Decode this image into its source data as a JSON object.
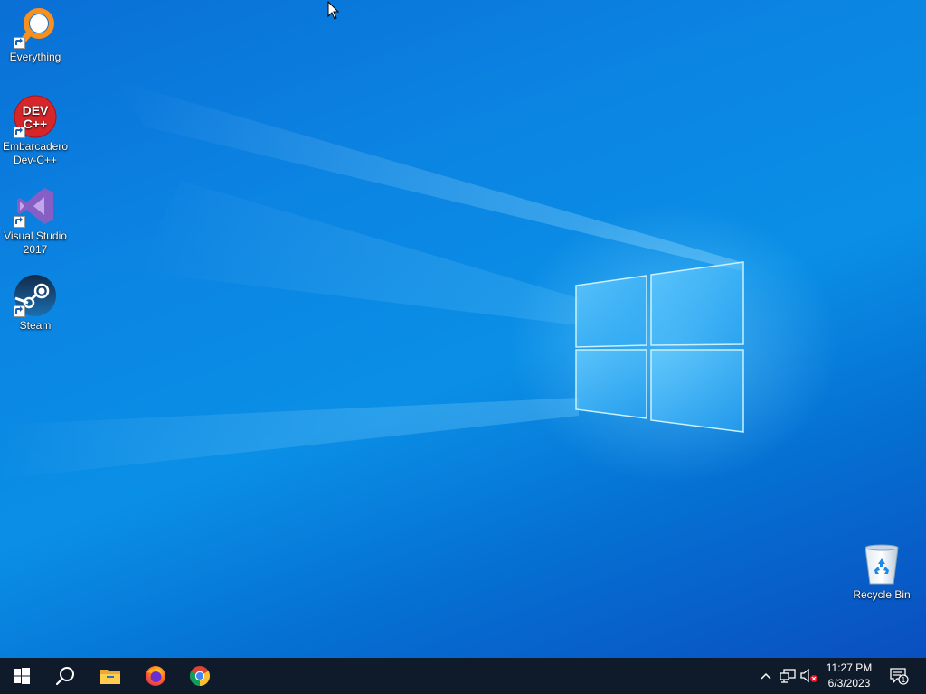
{
  "desktop": {
    "icons": [
      {
        "id": "everything",
        "label": "Everything"
      },
      {
        "id": "devcpp",
        "label": "Embarcadero Dev-C++"
      },
      {
        "id": "visual-studio",
        "label": "Visual Studio 2017"
      },
      {
        "id": "steam",
        "label": "Steam"
      },
      {
        "id": "recycle-bin",
        "label": "Recycle Bin"
      }
    ],
    "devcpp_logo_text": "DEV C++"
  },
  "taskbar": {
    "buttons": [
      "start-icon",
      "search-icon",
      "file-explorer-icon",
      "firefox-icon",
      "chrome-icon"
    ],
    "tray": {
      "icons": [
        "chevron-up-icon",
        "network-icon",
        "volume-muted-icon"
      ],
      "time": "11:27 PM",
      "date": "6/3/2023",
      "notification_count": "1"
    }
  },
  "colors": {
    "taskbar": "#0f1b2a",
    "desktop_primary": "#0a84e2",
    "desktop_dark": "#0a4fc0"
  }
}
